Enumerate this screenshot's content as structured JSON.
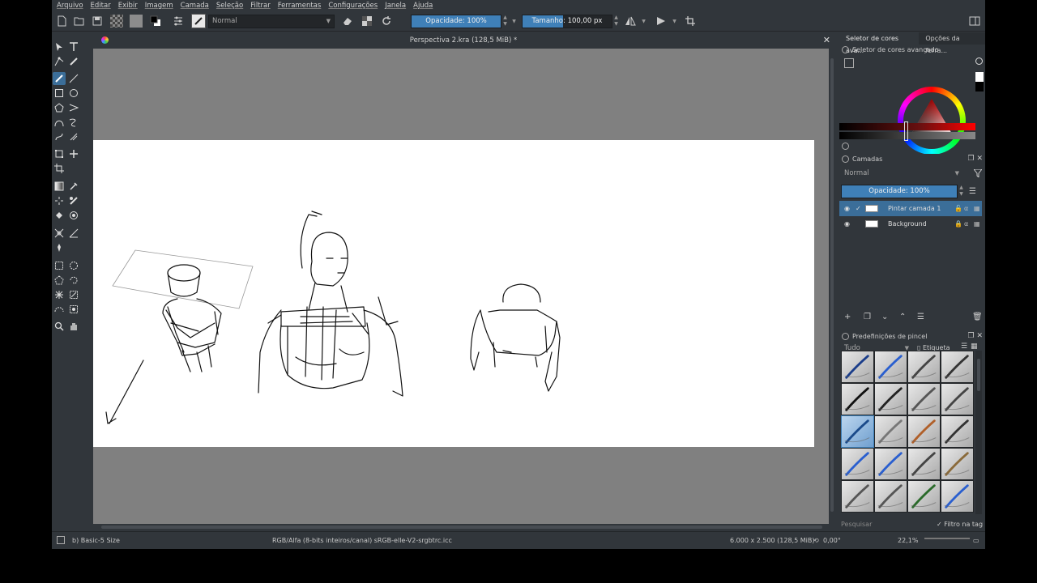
{
  "menu": [
    "Arquivo",
    "Editar",
    "Exibir",
    "Imagem",
    "Camada",
    "Seleção",
    "Filtrar",
    "Ferramentas",
    "Configurações",
    "Janela",
    "Ajuda"
  ],
  "toolbar": {
    "blend_mode": "Normal",
    "opacity_label": "Opacidade: 100%",
    "opacity_value": 1.0,
    "size_label": "Tamanho: 100,00 px"
  },
  "document": {
    "title": "Perspectiva 2.kra (128,5 MiB) *"
  },
  "dockers": {
    "top_tabs": [
      "Seletor de cores ava...",
      "Opções da ferra..."
    ],
    "color_selector_title": "Seletor de cores avançado",
    "layers_title": "Camadas",
    "layers_blend": "Normal",
    "layers_opacity": "Opacidade: 100%",
    "layers": [
      {
        "name": "Pintar camada 1",
        "selected": true
      },
      {
        "name": "Background",
        "selected": false
      }
    ],
    "brushes_title": "Predefinições de pincel",
    "brushes_filter": "Tudo",
    "brushes_tag": "Etiqueta",
    "search_placeholder": "Pesquisar",
    "filter_in_tag": "Filtro na tag"
  },
  "status": {
    "brush": "b) Basic-5 Size",
    "color_model": "RGB/Alfa (8-bits inteiros/canal)  sRGB-elle-V2-srgbtrc.icc",
    "dimensions": "6.000 x 2.500 (128,5 MiB)",
    "rotation": "0,00°",
    "zoom": "22,1%"
  },
  "colors": {
    "accent": "#3f80b8",
    "background": "#31363b",
    "canvas_bg": "#808080"
  }
}
